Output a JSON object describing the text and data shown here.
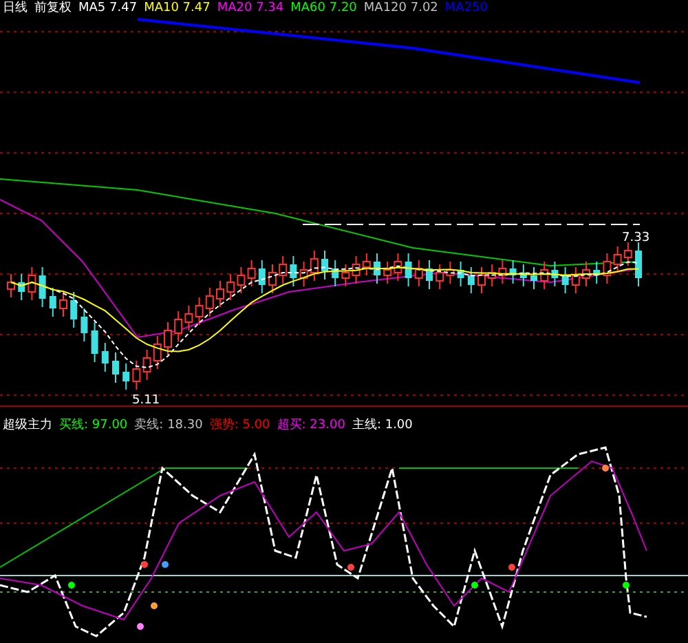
{
  "price_panel": {
    "legend": [
      {
        "text": "日线",
        "color": "#ffffff"
      },
      {
        "text": "前复权",
        "color": "#ffffff"
      },
      {
        "text": "MA5 7.47",
        "color": "#ffffff"
      },
      {
        "text": "MA10 7.47",
        "color": "#ffff00"
      },
      {
        "text": "MA20 7.34",
        "color": "#ff00ff"
      },
      {
        "text": "MA60 7.20",
        "color": "#00ff00"
      },
      {
        "text": "MA120 7.02",
        "color": "#c0c0c0"
      },
      {
        "text": "MA250",
        "color": "#0000ff"
      }
    ],
    "high_label": "7.33",
    "low_label": "5.11"
  },
  "indicator_panel": {
    "legend": [
      {
        "text": "超级主力",
        "color": "#ffffff"
      },
      {
        "text": "买线: 97.00",
        "color": "#00ff00"
      },
      {
        "text": "卖线: 18.30",
        "color": "#c0c0c0"
      },
      {
        "text": "强势: 5.00",
        "color": "#ff0000"
      },
      {
        "text": "超买: 23.00",
        "color": "#ff00ff"
      },
      {
        "text": "主线: 1.00",
        "color": "#ffffff"
      }
    ]
  }
}
